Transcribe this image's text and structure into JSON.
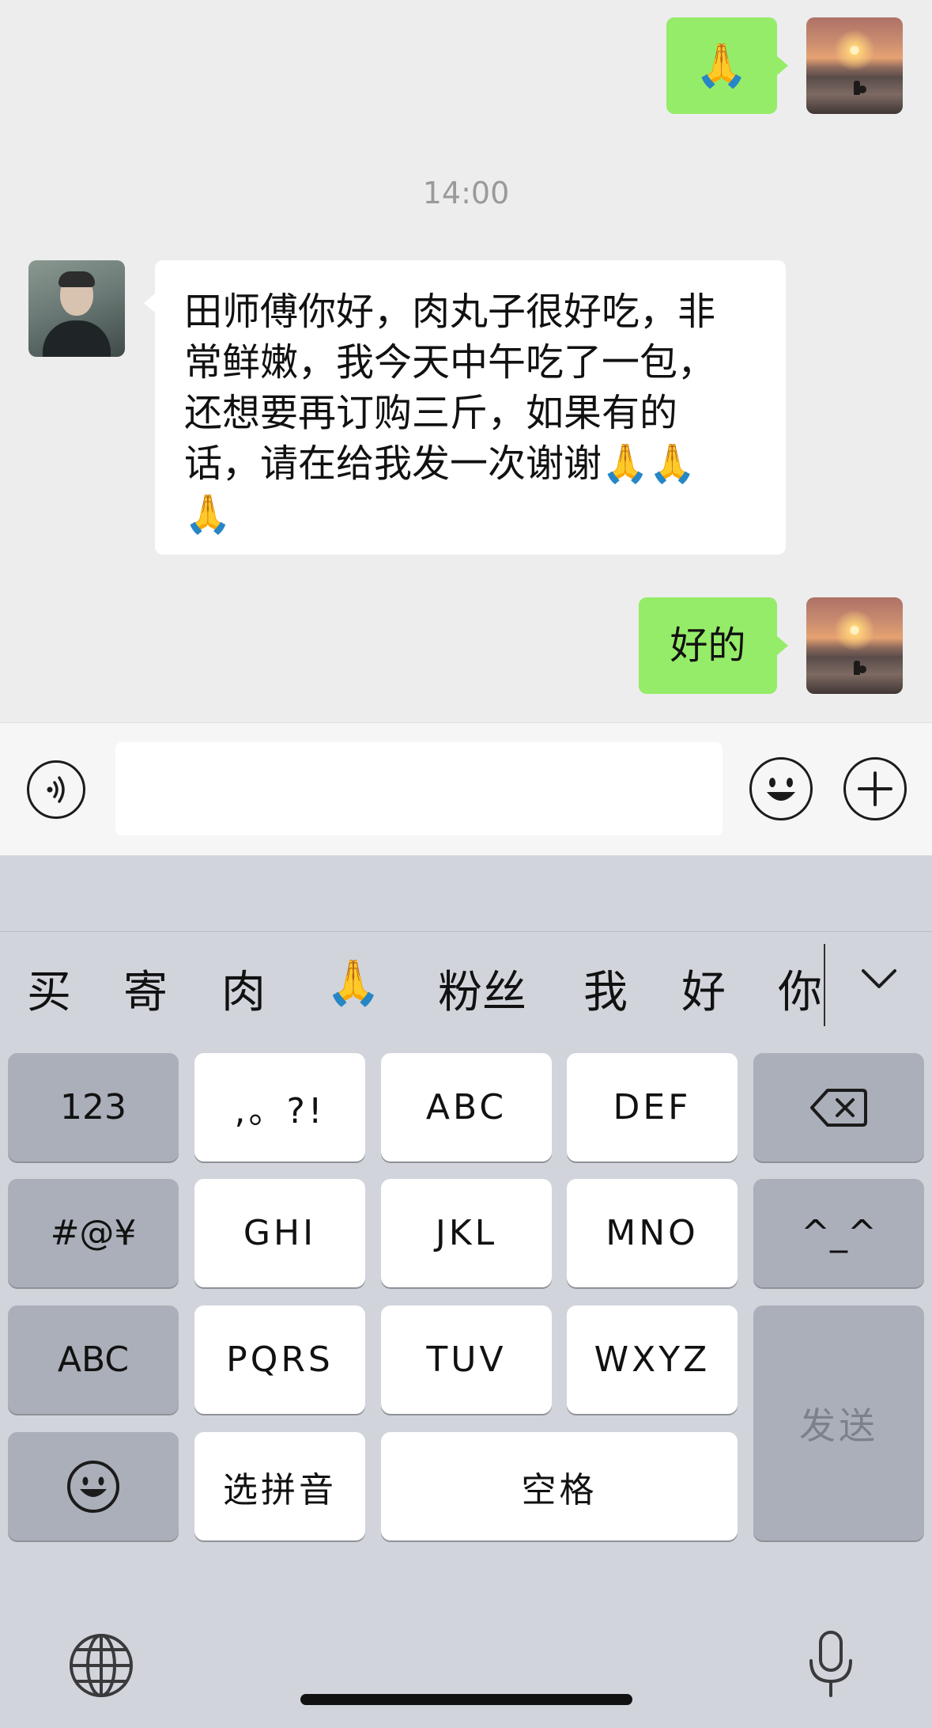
{
  "chat": {
    "messages": [
      {
        "from": "me",
        "text": "🙏"
      },
      {
        "from": "them",
        "lines": [
          "田师傅你好，肉丸子很好吃，非",
          "常鲜嫩，我今天中午吃了一包，",
          "还想要再订购三斤，如果有的",
          "话，请在给我发一次谢谢🙏🙏",
          "🙏"
        ]
      },
      {
        "from": "me",
        "text": "好的"
      }
    ],
    "timestamp": "14:00",
    "colors": {
      "background": "#ededed",
      "my_bubble": "#95ec69",
      "their_bubble": "#ffffff"
    }
  },
  "input_bar": {
    "voice_icon": "voice-icon",
    "emoji_icon": "emoji-icon",
    "plus_icon": "plus-icon",
    "value": ""
  },
  "keyboard": {
    "candidates": [
      "买",
      "寄",
      "肉",
      "🙏",
      "粉丝",
      "我",
      "好",
      "你"
    ],
    "collapse_icon": "chevron-down-icon",
    "keys": {
      "num": "123",
      "punct": ",。?!",
      "abc": "ABC",
      "def": "DEF",
      "delete_icon": "backspace-icon",
      "symbols": "#@¥",
      "ghi": "GHI",
      "jkl": "JKL",
      "mno": "MNO",
      "kaomoji": "^_^",
      "abc_mode": "ABC",
      "pqrs": "PQRS",
      "tuv": "TUV",
      "wxyz": "WXYZ",
      "send": "发送",
      "emoji_icon": "emoji-icon",
      "pinyin": "选拼音",
      "space": "空格"
    },
    "globe_icon": "globe-icon",
    "mic_icon": "microphone-icon"
  }
}
